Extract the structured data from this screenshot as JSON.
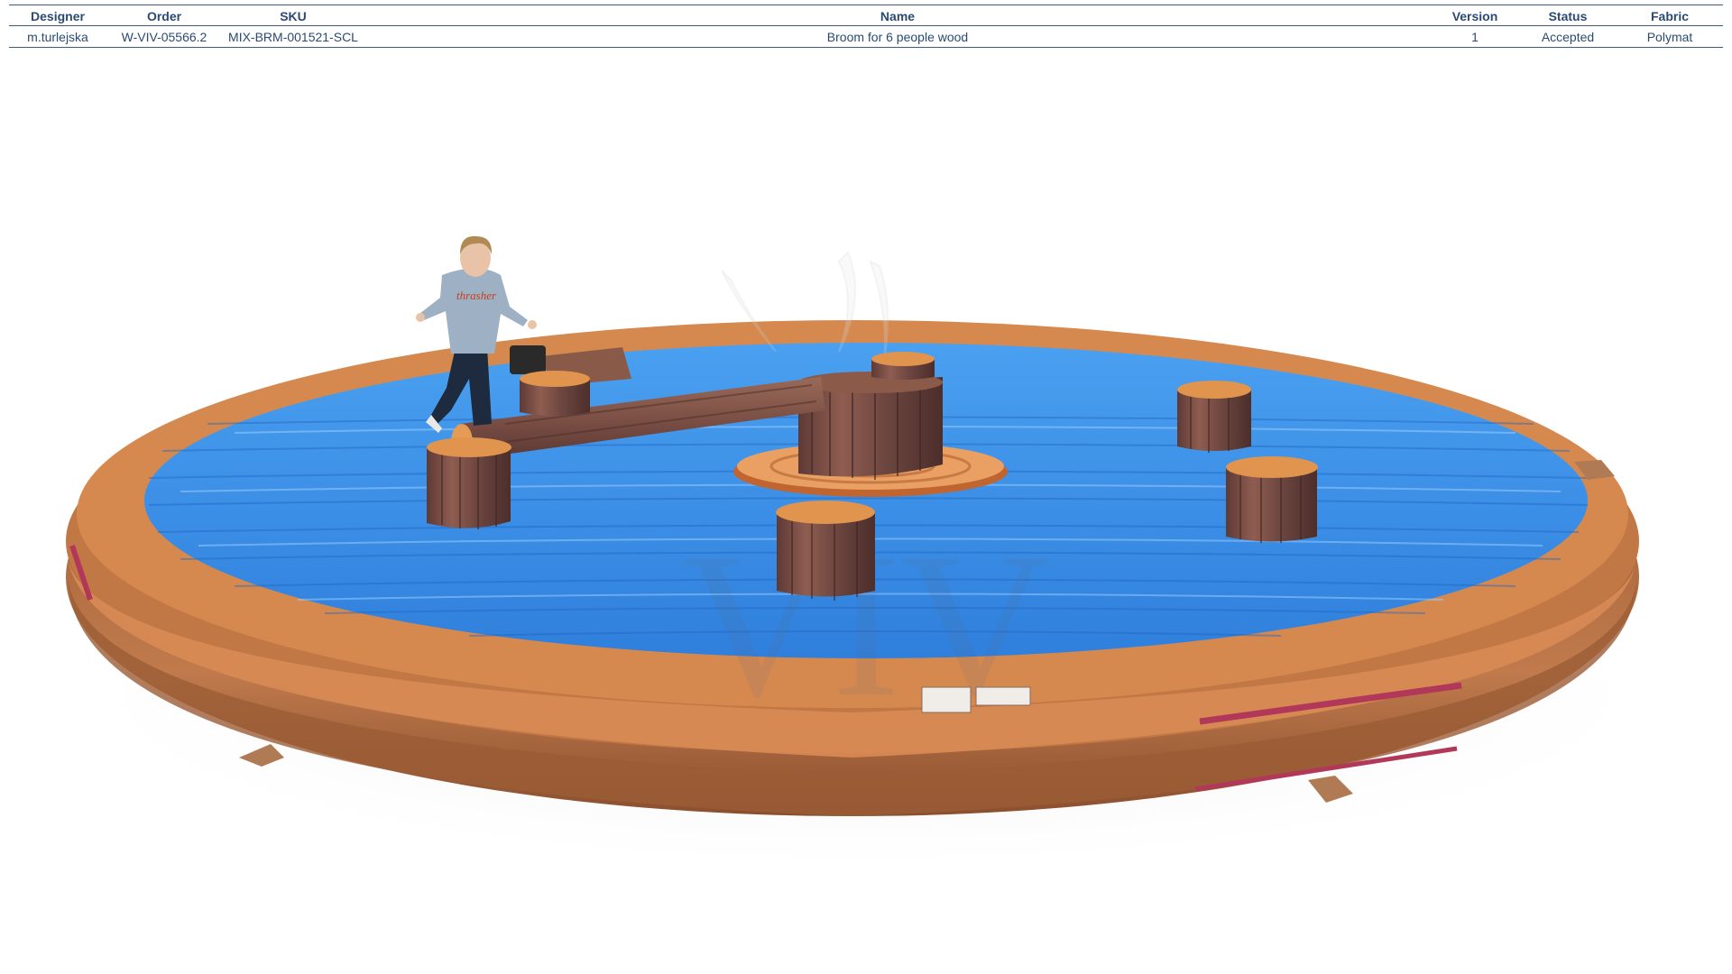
{
  "table": {
    "headers": {
      "designer": "Designer",
      "order": "Order",
      "sku": "SKU",
      "name": "Name",
      "version": "Version",
      "status": "Status",
      "fabric": "Fabric"
    },
    "row": {
      "designer": "m.turlejska",
      "order": "W-VIV-05566.2",
      "sku": "MIX-BRM-001521-SCL",
      "name": "Broom for 6 people wood",
      "version": "1",
      "status": "Accepted",
      "fabric": "Polymat"
    }
  },
  "render": {
    "watermark": "VIV",
    "shirt_print": "thrasher",
    "colors": {
      "mat_blue": "#3a8ee6",
      "rim_brown": "#a9673c",
      "rim_orange": "#d9834a",
      "stump_bark": "#7a4e45",
      "stump_top": "#e0944e",
      "accent_stripe": "#b2385a"
    }
  }
}
